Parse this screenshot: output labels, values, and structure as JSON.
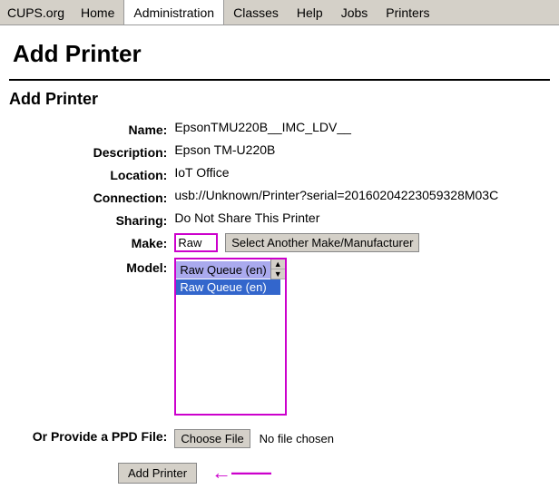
{
  "navbar": {
    "brand": "CUPS.org",
    "items": [
      {
        "label": "Home",
        "active": false
      },
      {
        "label": "Administration",
        "active": true
      },
      {
        "label": "Classes",
        "active": false
      },
      {
        "label": "Help",
        "active": false
      },
      {
        "label": "Jobs",
        "active": false
      },
      {
        "label": "Printers",
        "active": false
      }
    ]
  },
  "page_title": "Add Printer",
  "section_title": "Add Printer",
  "form": {
    "name_label": "Name:",
    "name_value": "EpsonTMU220B__IMC_LDV__",
    "description_label": "Description:",
    "description_value": "Epson TM-U220B",
    "location_label": "Location:",
    "location_value": "IoT Office",
    "connection_label": "Connection:",
    "connection_value": "usb://Unknown/Printer?serial=20160204223059328M03C",
    "sharing_label": "Sharing:",
    "sharing_value": "Do Not Share This Printer",
    "make_label": "Make:",
    "make_value": "Raw",
    "make_button": "Select Another Make/Manufacturer",
    "model_label": "Model:",
    "model_selected": "Raw Queue (en)",
    "model_options": [
      "Raw Queue (en)"
    ],
    "ppd_label": "Or Provide a PPD File:",
    "choose_file_btn": "Choose File",
    "no_file_text": "No file chosen",
    "add_printer_btn": "Add Printer"
  },
  "arrow": "→"
}
